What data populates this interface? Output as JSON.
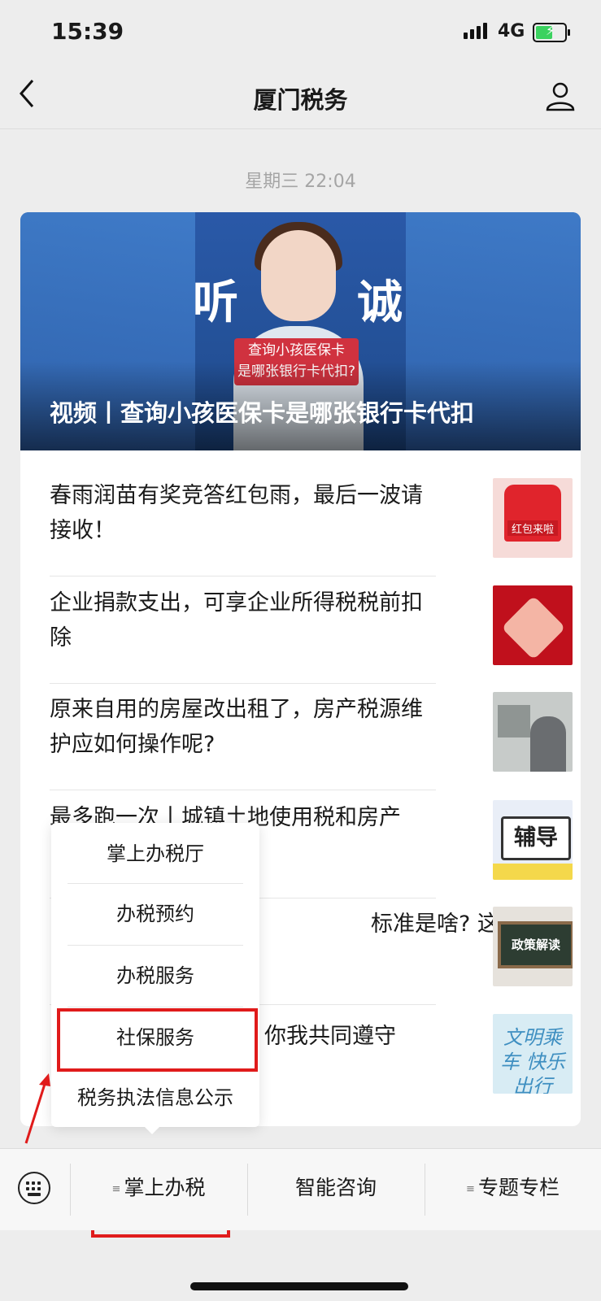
{
  "status_bar": {
    "time": "15:39",
    "network": "4G"
  },
  "nav": {
    "title": "厦门税务",
    "back_icon": "chevron-left-icon",
    "profile_icon": "person-icon"
  },
  "timestamp": "星期三 22:04",
  "hero": {
    "title": "视频丨查询小孩医保卡是哪张银行卡代扣",
    "sticker_text": "查询小孩医保卡\n是哪张银行卡代扣?",
    "bg_chars": [
      "听",
      "诚"
    ]
  },
  "articles": [
    {
      "title": "春雨润苗有奖竞答红包雨，最后一波请接收！",
      "thumb_label": "红包来啦"
    },
    {
      "title": "企业捐款支出，可享企业所得税税前扣除"
    },
    {
      "title": "原来自用的房屋改出租了，房产税源维护应如何操作呢?"
    },
    {
      "title": "最多跑一次丨城镇土地使用税和房产",
      "thumb_label": "辅导"
    },
    {
      "title": "标准是啥? 这个",
      "thumb_label": "政策解读"
    },
    {
      "title": "你我共同遵守",
      "thumb_label": "文明乘车 快乐出行"
    }
  ],
  "popup_menu": {
    "items": [
      "掌上办税厅",
      "办税预约",
      "办税服务",
      "社保服务",
      "税务执法信息公示"
    ],
    "highlighted": "社保服务"
  },
  "bottom_menu": {
    "keyboard_icon": "keyboard-icon",
    "tabs": [
      "掌上办税",
      "智能咨询",
      "专题专栏"
    ],
    "highlighted": "掌上办税"
  },
  "colors": {
    "highlight": "#e01b1b",
    "background": "#ededed",
    "card": "#ffffff"
  }
}
